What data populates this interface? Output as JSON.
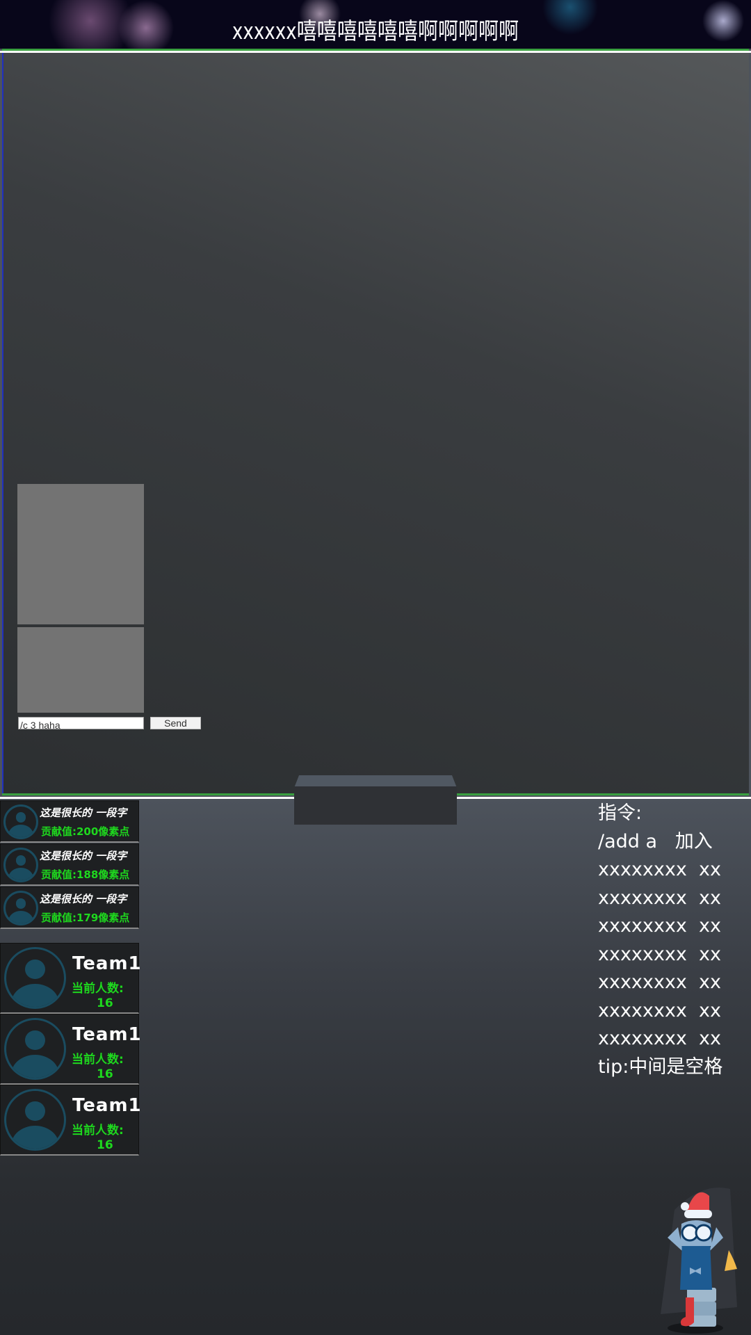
{
  "title": "xxxxxx嘻嘻嘻嘻嘻嘻啊啊啊啊啊",
  "chat": {
    "input_value": "/c 3 haha",
    "send_label": "Send"
  },
  "contributors": [
    {
      "name": "这是很长的 一段字",
      "score": "贡献值:200像素点"
    },
    {
      "name": "这是很长的 一段字",
      "score": "贡献值:188像素点"
    },
    {
      "name": "这是很长的 一段字",
      "score": "贡献值:179像素点"
    }
  ],
  "teams": [
    {
      "name": "Team1",
      "label": "当前人数:",
      "count": "16"
    },
    {
      "name": "Team1",
      "label": "当前人数:",
      "count": "16"
    },
    {
      "name": "Team1",
      "label": "当前人数:",
      "count": "16"
    }
  ],
  "commands": {
    "heading": "指令:",
    "lines": [
      "/add a   加入",
      "xxxxxxxx  xx",
      "xxxxxxxx  xx",
      "xxxxxxxx  xx",
      "xxxxxxxx  xx",
      "xxxxxxxx  xx",
      "xxxxxxxx  xx",
      "xxxxxxxx  xx"
    ],
    "tip": "tip:中间是空格"
  },
  "colors": {
    "accent_green": "#1ed81e",
    "avatar": "#1a4c60"
  }
}
